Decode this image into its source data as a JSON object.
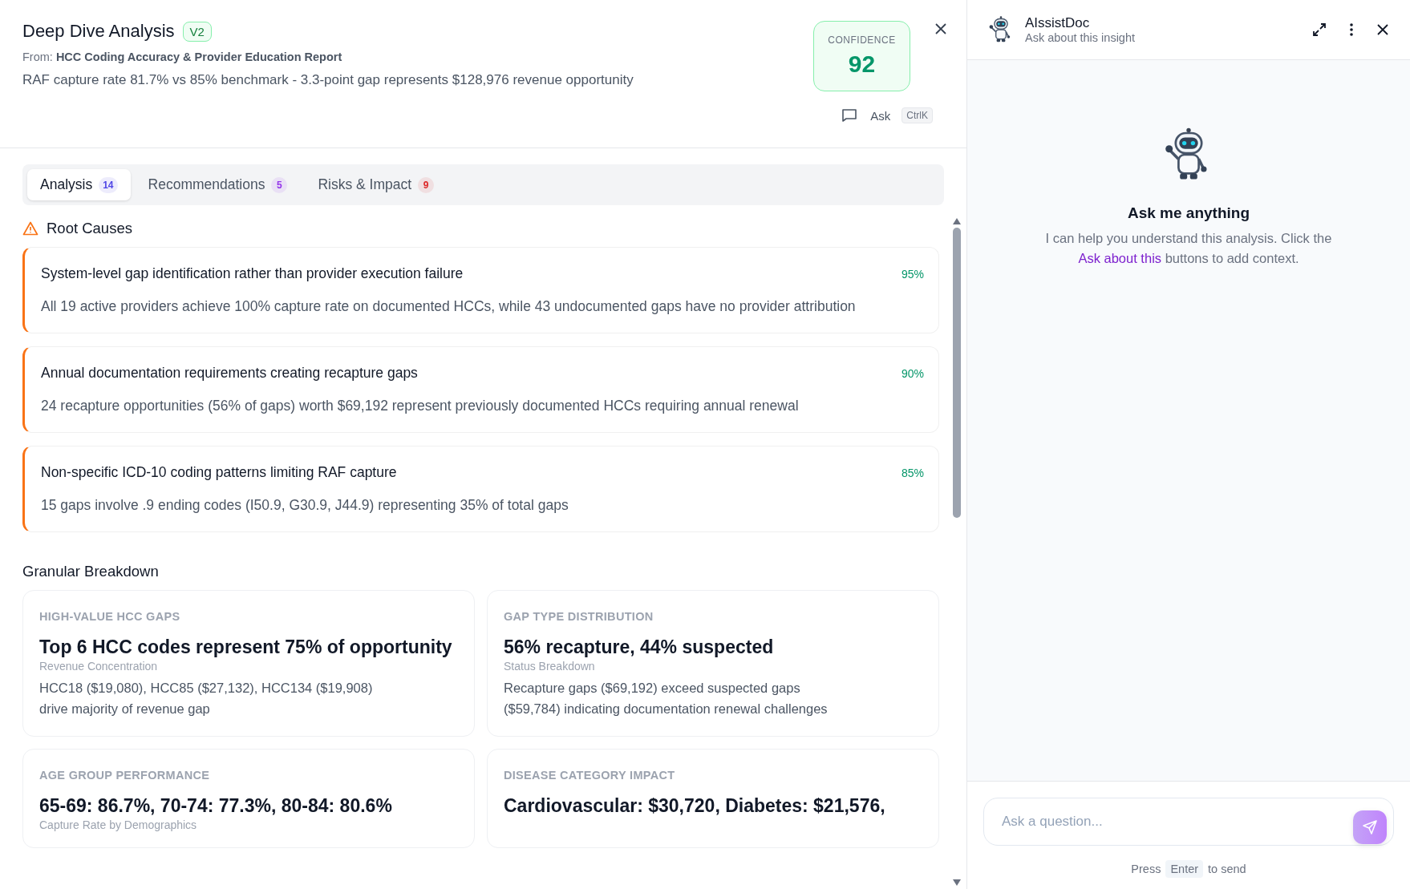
{
  "header": {
    "title": "Deep Dive Analysis",
    "version": "V2",
    "source_prefix": "From:",
    "source": "HCC Coding Accuracy & Provider Education Report",
    "summary": "RAF capture rate 81.7% vs 85% benchmark - 3.3-point gap represents $128,976 revenue opportunity",
    "confidence": {
      "label": "CONFIDENCE",
      "value": "92"
    },
    "ask": {
      "label": "Ask",
      "shortcut": "CtrlK"
    }
  },
  "tabs": [
    {
      "label": "Analysis",
      "count": "14",
      "selected": true,
      "color": "#4f46e5"
    },
    {
      "label": "Recommendations",
      "count": "5",
      "selected": false,
      "color": "#9333ea"
    },
    {
      "label": "Risks & Impact",
      "count": "9",
      "selected": false,
      "color": "#dc2626"
    }
  ],
  "root_causes": {
    "title": "Root Causes",
    "items": [
      {
        "title": "System-level gap identification rather than provider execution failure",
        "detail": "All 19 active providers achieve 100% capture rate on documented HCCs, while 43 undocumented gaps have no provider attribution",
        "confidence": "95%"
      },
      {
        "title": "Annual documentation requirements creating recapture gaps",
        "detail": "24 recapture opportunities (56% of gaps) worth $69,192 represent previously documented HCCs requiring annual renewal",
        "confidence": "90%"
      },
      {
        "title": "Non-specific ICD-10 coding patterns limiting RAF capture",
        "detail": "15 gaps involve .9 ending codes (I50.9, G30.9, J44.9) representing 35% of total gaps",
        "confidence": "85%"
      }
    ]
  },
  "breakdown": {
    "title": "Granular Breakdown",
    "cards": [
      {
        "label": "HIGH-VALUE HCC GAPS",
        "value": "Top 6 HCC codes represent 75% of opportunity",
        "sublabel": "Revenue Concentration",
        "detail": "HCC18 ($19,080), HCC85 ($27,132), HCC134 ($19,908) drive majority of revenue gap"
      },
      {
        "label": "GAP TYPE DISTRIBUTION",
        "value": "56% recapture, 44% suspected",
        "sublabel": "Status Breakdown",
        "detail": "Recapture gaps ($69,192) exceed suspected gaps ($59,784) indicating documentation renewal challenges"
      },
      {
        "label": "AGE GROUP PERFORMANCE",
        "value": "65-69: 86.7%, 70-74: 77.3%, 80-84: 80.6%",
        "sublabel": "Capture Rate by Demographics"
      },
      {
        "label": "DISEASE CATEGORY IMPACT",
        "value": "Cardiovascular: $30,720, Diabetes: $21,576,"
      }
    ]
  },
  "assistant": {
    "name": "AIssistDoc",
    "subtitle": "Ask about this insight",
    "empty_title": "Ask me anything",
    "empty_text_before": "I can help you understand this analysis. Click the",
    "empty_link": "Ask about this",
    "empty_text_after": "buttons to add context.",
    "input_placeholder": "Ask a question...",
    "hint_before": "Press",
    "hint_key": "Enter",
    "hint_after": "to send"
  }
}
